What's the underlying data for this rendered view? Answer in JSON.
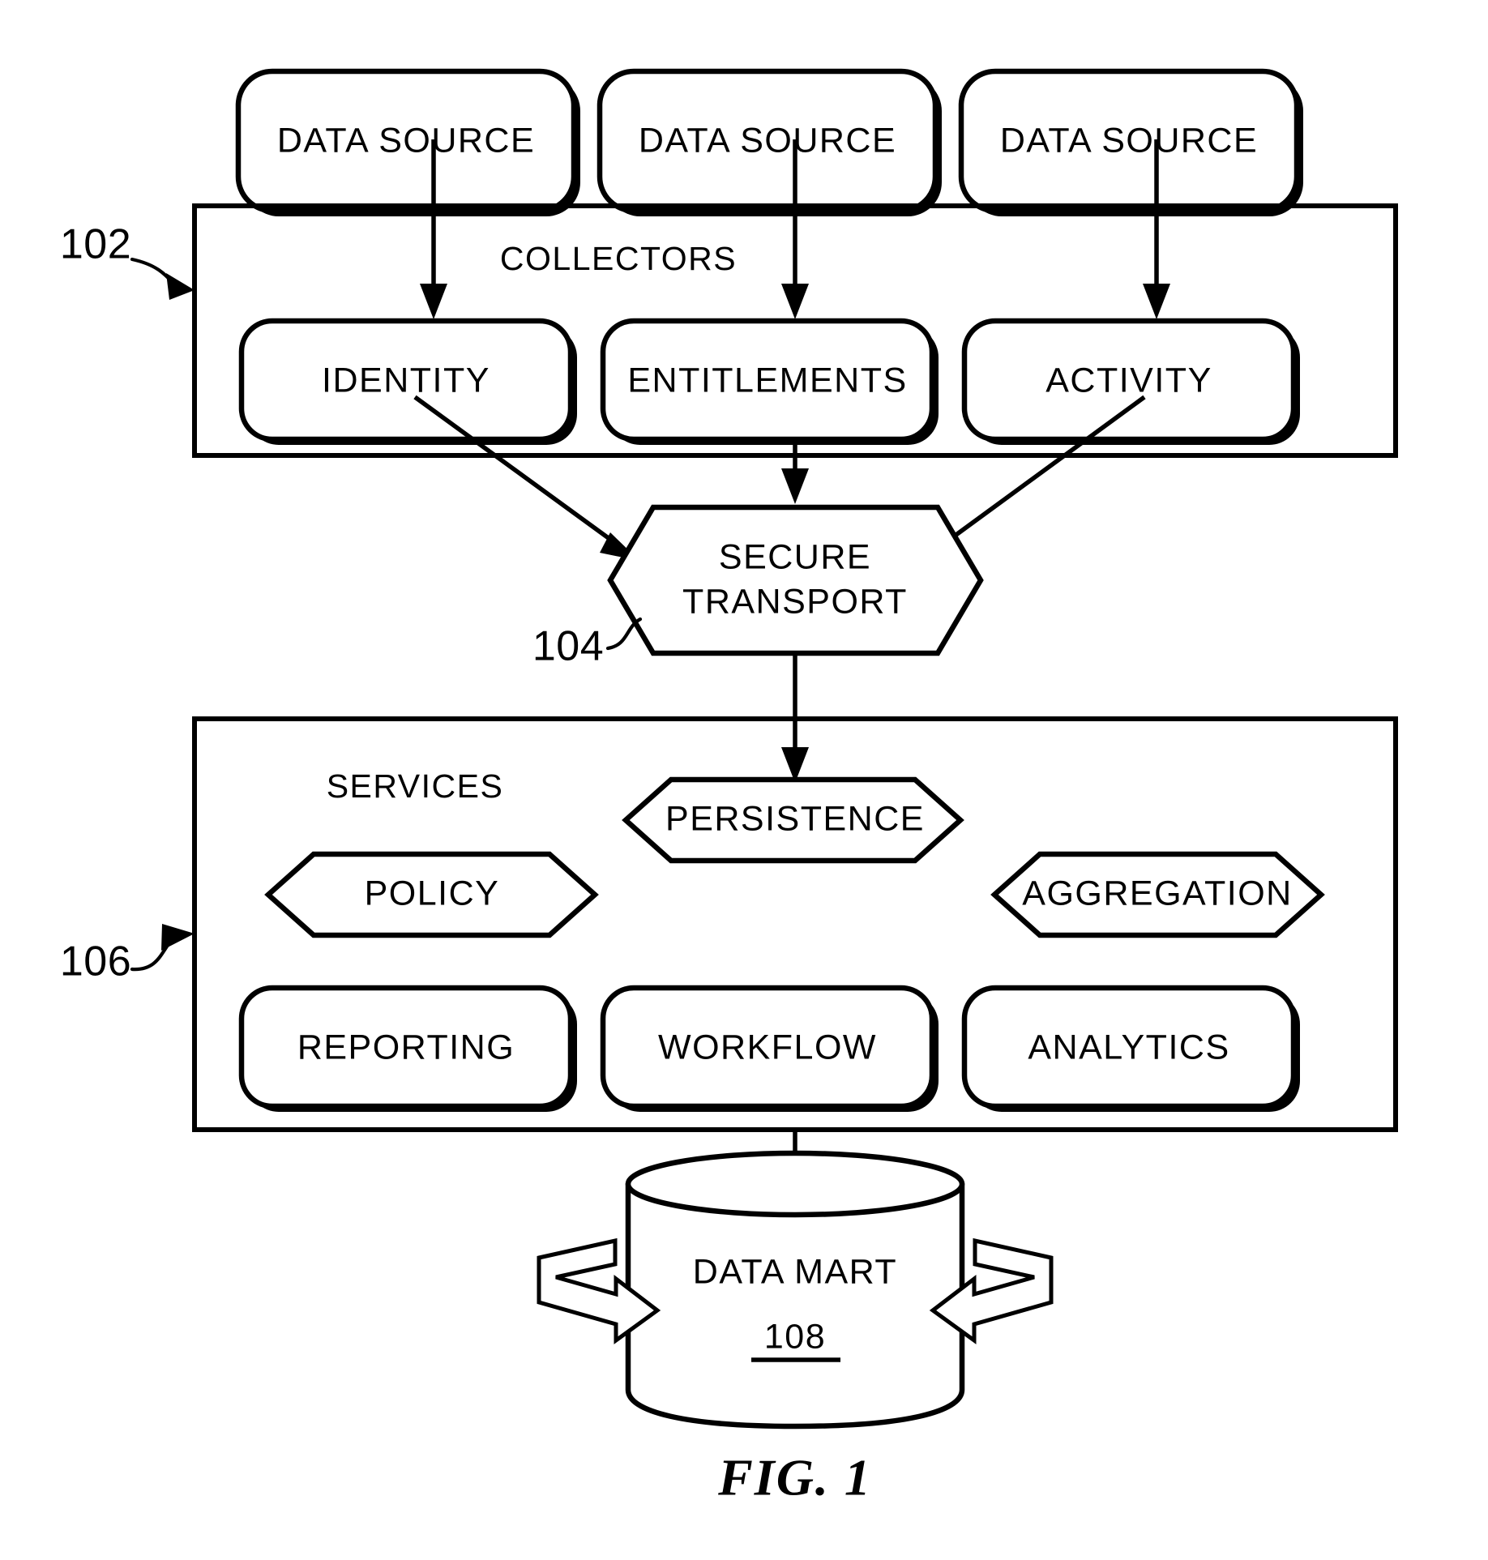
{
  "figure": {
    "caption": "FIG. 1"
  },
  "data_sources": [
    {
      "label": "DATA SOURCE"
    },
    {
      "label": "DATA SOURCE"
    },
    {
      "label": "DATA SOURCE"
    }
  ],
  "collectors": {
    "ref": "102",
    "title": "COLLECTORS",
    "items": [
      {
        "label": "IDENTITY"
      },
      {
        "label": "ENTITLEMENTS"
      },
      {
        "label": "ACTIVITY"
      }
    ]
  },
  "transport": {
    "ref": "104",
    "line1": "SECURE",
    "line2": "TRANSPORT"
  },
  "services": {
    "ref": "106",
    "title": "SERVICES",
    "hex_items": [
      {
        "label": "PERSISTENCE"
      },
      {
        "label": "POLICY"
      },
      {
        "label": "AGGREGATION"
      }
    ],
    "box_items": [
      {
        "label": "REPORTING"
      },
      {
        "label": "WORKFLOW"
      },
      {
        "label": "ANALYTICS"
      }
    ]
  },
  "data_mart": {
    "label": "DATA MART",
    "ref": "108"
  },
  "colors": {
    "ink": "#000000",
    "paper": "#ffffff"
  }
}
